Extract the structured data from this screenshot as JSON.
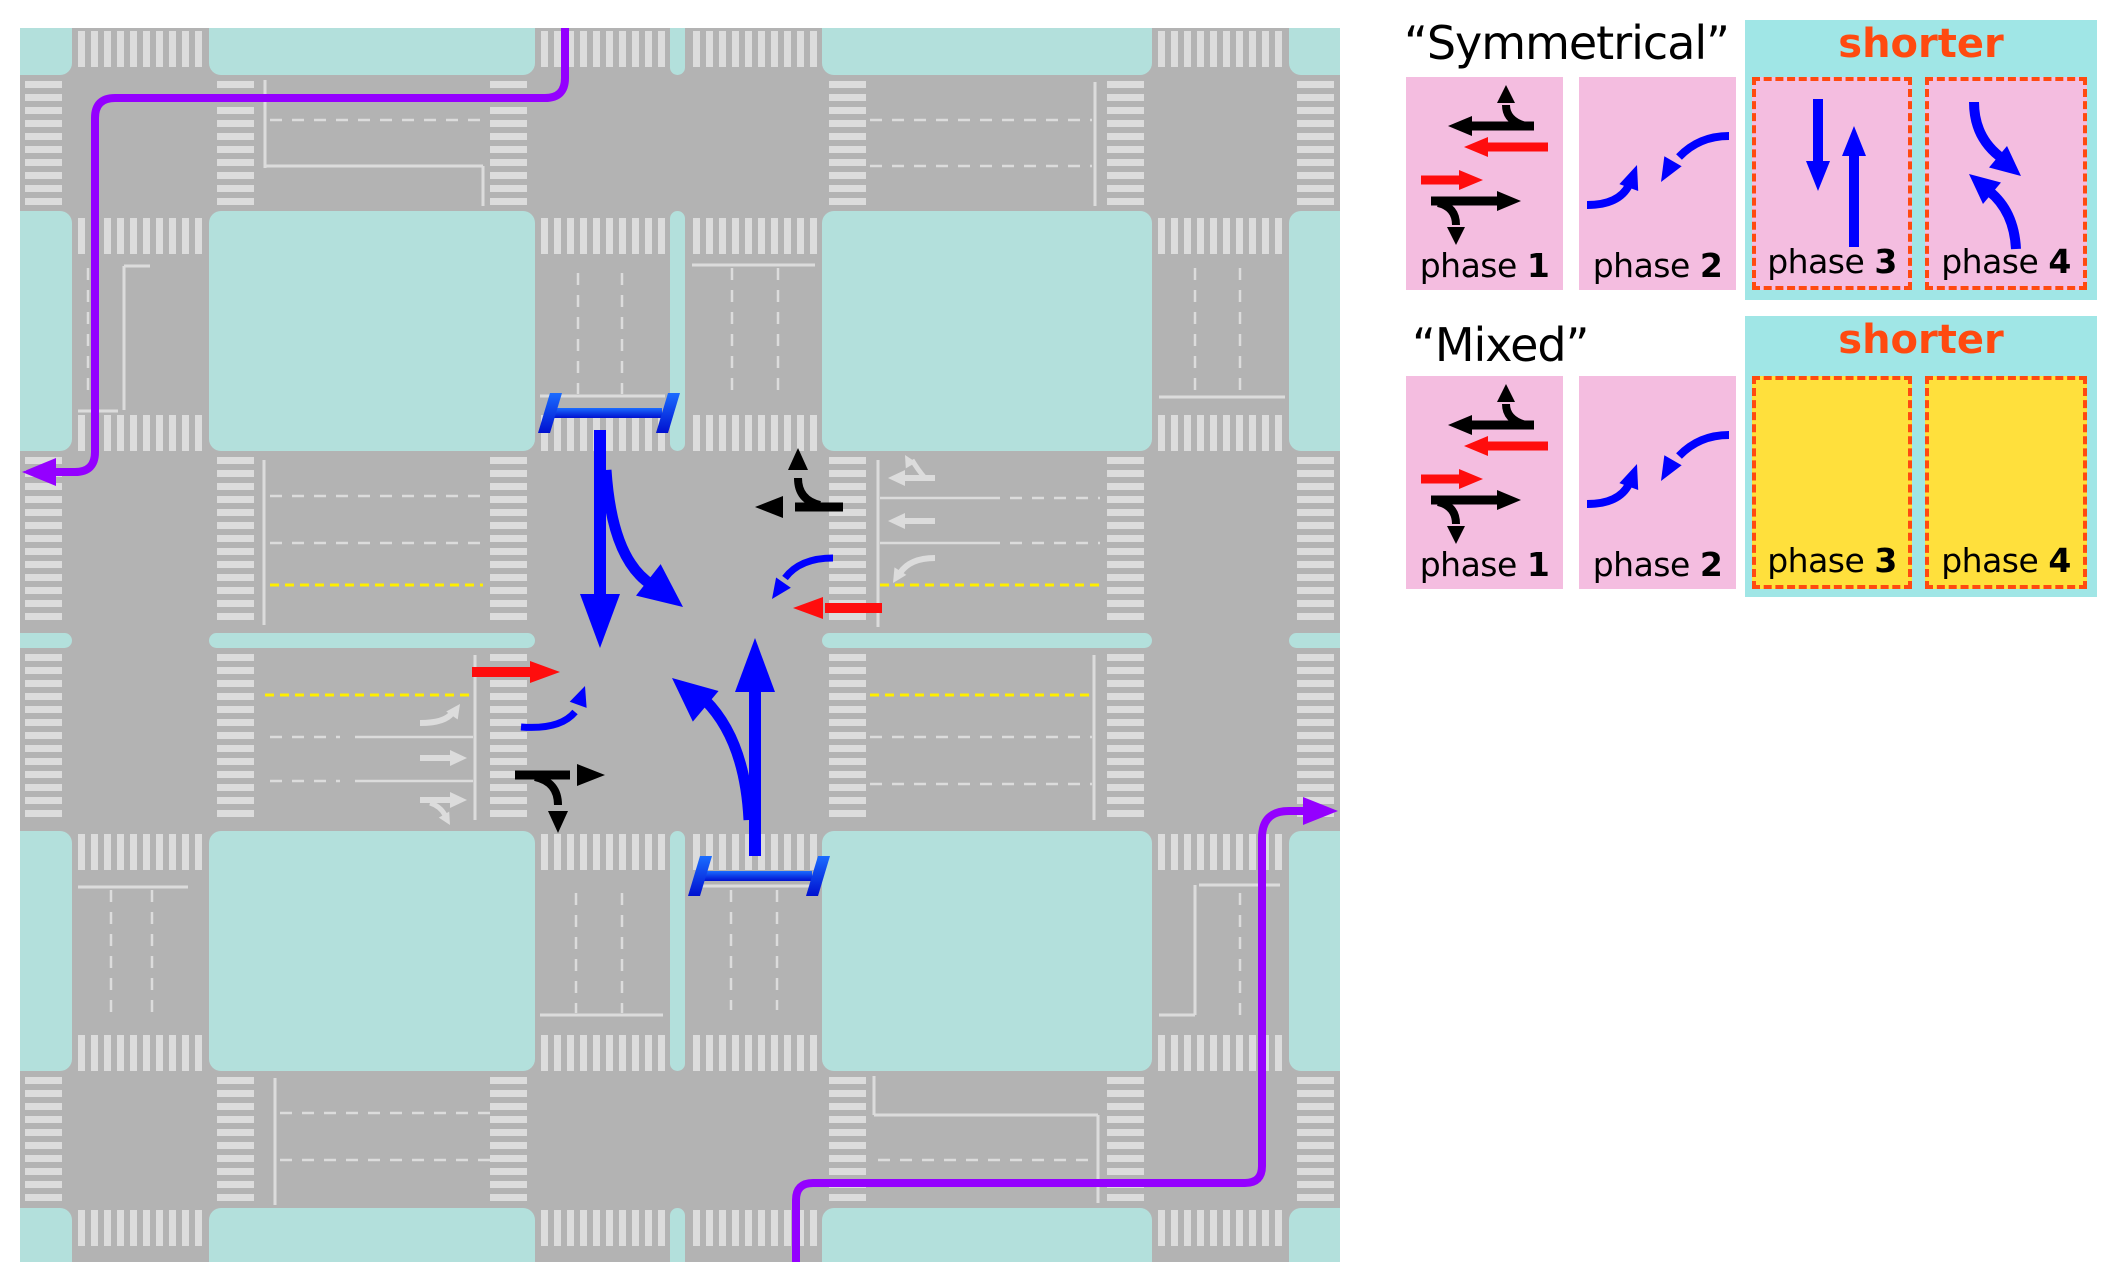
{
  "figure": {
    "description": "Signalized intersection diagram with lane arrows and two phasing schemes",
    "colors": {
      "block": "#b3e0dc",
      "road": "#b3b3b3",
      "marking": "#dcdcdc",
      "center_line": "#ffee00",
      "purple_route": "#9400ff",
      "blue_movement": "#0000ff",
      "red_movement": "#ff0d0d",
      "black_movement": "#000000",
      "shorter_bg": "#a0e6e6",
      "shorter_text": "#ff4a10",
      "card_pink": "#f4bde0",
      "card_yellow": "#ffe03c"
    }
  },
  "map": {
    "movements": [
      {
        "id": "north-approach-through",
        "color": "blue",
        "direction": "southbound through"
      },
      {
        "id": "north-approach-right",
        "color": "blue",
        "direction": "southbound right-turn"
      },
      {
        "id": "south-approach-through",
        "color": "blue",
        "direction": "northbound through"
      },
      {
        "id": "south-approach-right",
        "color": "blue",
        "direction": "northbound right-turn"
      },
      {
        "id": "east-approach-through",
        "color": "red",
        "direction": "westbound through"
      },
      {
        "id": "west-approach-through",
        "color": "red",
        "direction": "eastbound through"
      },
      {
        "id": "east-approach-left",
        "color": "blue",
        "direction": "westbound left-turn"
      },
      {
        "id": "west-approach-left",
        "color": "blue",
        "direction": "eastbound left-turn"
      },
      {
        "id": "east-approach-right",
        "color": "black",
        "direction": "westbound through/right"
      },
      {
        "id": "west-approach-right",
        "color": "black",
        "direction": "eastbound through/right"
      }
    ],
    "routes": [
      {
        "id": "purple-route-northwest",
        "color": "purple"
      },
      {
        "id": "purple-route-southeast",
        "color": "purple"
      }
    ]
  },
  "schemes": [
    {
      "title": "“Symmetrical”",
      "shorter_label": "shorter",
      "phases": [
        {
          "word": "phase",
          "number": "1",
          "style": "pink",
          "dashed": false
        },
        {
          "word": "phase",
          "number": "2",
          "style": "pink",
          "dashed": false
        },
        {
          "word": "phase",
          "number": "3",
          "style": "pink",
          "dashed": true
        },
        {
          "word": "phase",
          "number": "4",
          "style": "pink",
          "dashed": true
        }
      ]
    },
    {
      "title": "“Mixed”",
      "shorter_label": "shorter",
      "phases": [
        {
          "word": "phase",
          "number": "1",
          "style": "pink",
          "dashed": false
        },
        {
          "word": "phase",
          "number": "2",
          "style": "pink",
          "dashed": false
        },
        {
          "word": "phase",
          "number": "3",
          "style": "yellow",
          "dashed": true
        },
        {
          "word": "phase",
          "number": "4",
          "style": "yellow",
          "dashed": true
        }
      ]
    }
  ]
}
